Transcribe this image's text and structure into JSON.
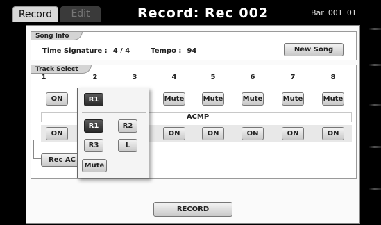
{
  "tabs": {
    "record": "Record",
    "edit": "Edit"
  },
  "title": "Record: Rec 002",
  "bar": {
    "label": "Bar",
    "value": "001",
    "beat": "01"
  },
  "song_info": {
    "section_label": "Song Info",
    "time_sig_label": "Time Signature :",
    "time_sig_value": "4 / 4",
    "tempo_label": "Tempo :",
    "tempo_value": "94",
    "new_song_label": "New Song"
  },
  "track_select": {
    "section_label": "Track Select",
    "columns": [
      "1",
      "2",
      "3",
      "4",
      "5",
      "6",
      "7",
      "8"
    ],
    "row1": [
      "ON",
      "R1",
      "",
      "Mute",
      "Mute",
      "Mute",
      "Mute",
      "Mute"
    ],
    "acmp_label": "ACMP",
    "row2": [
      "ON",
      "",
      "",
      "ON",
      "ON",
      "ON",
      "ON",
      "ON"
    ],
    "rec_acmp_label": "Rec AC"
  },
  "popup": {
    "selected": "R1",
    "options": [
      "R1",
      "R2",
      "R3",
      "L",
      "Mute"
    ]
  },
  "record_button": "RECORD",
  "colors": {
    "selected": "#3a3a3a",
    "panel": "#fafafa",
    "background": "#000000"
  }
}
